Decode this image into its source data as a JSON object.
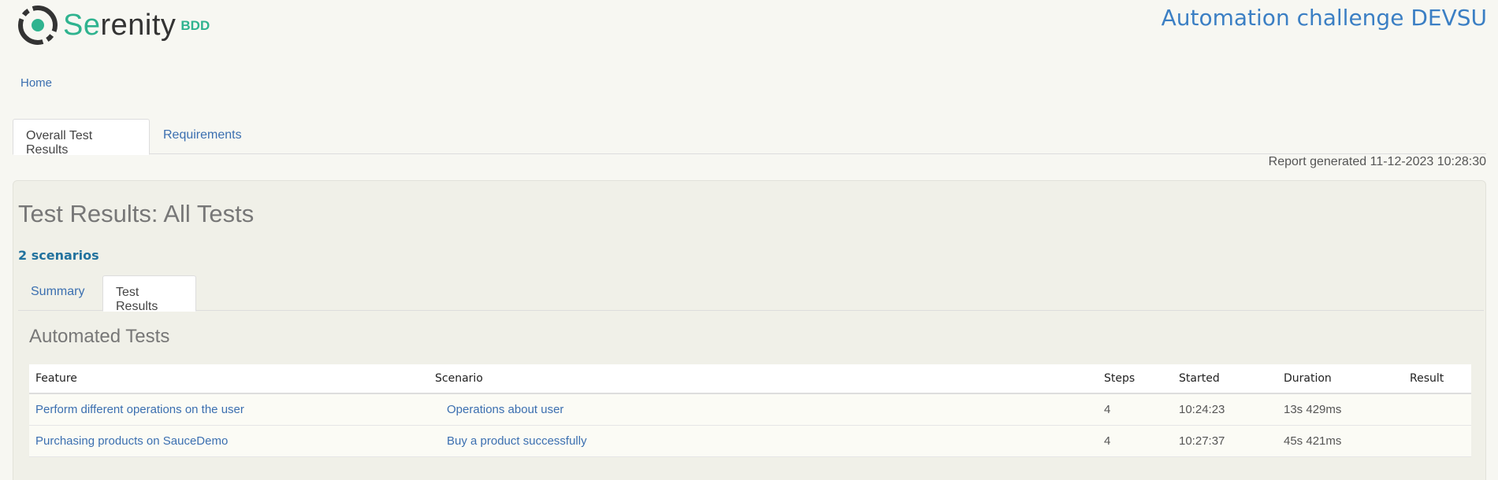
{
  "header": {
    "logo_prefix": "Se",
    "logo_rest": "renity",
    "logo_suffix": "BDD",
    "project_title": "Automation challenge DEVSU"
  },
  "breadcrumb": {
    "home": "Home"
  },
  "top_tabs": [
    {
      "label": "Overall Test Results",
      "active": true
    },
    {
      "label": "Requirements",
      "active": false
    }
  ],
  "report_generated": "Report generated 11-12-2023 10:28:30",
  "results": {
    "title": "Test Results: All Tests",
    "scenario_count": "2 scenarios",
    "tabs": [
      {
        "label": "Summary",
        "active": false
      },
      {
        "label": "Test Results",
        "active": true
      }
    ],
    "section_title": "Automated Tests"
  },
  "table": {
    "columns": [
      "Feature",
      "Scenario",
      "Steps",
      "Started",
      "Duration",
      "Result"
    ],
    "rows": [
      {
        "feature": "Perform different operations on the user",
        "scenario": "Operations about user",
        "steps": "4",
        "started": "10:24:23",
        "duration": "13s 429ms",
        "result": ""
      },
      {
        "feature": "Purchasing products on SauceDemo",
        "scenario": "Buy a product successfully",
        "steps": "4",
        "started": "10:27:37",
        "duration": "45s 421ms",
        "result": ""
      }
    ]
  },
  "colors": {
    "brand_green": "#2fb38f",
    "link_blue": "#3b6fb0",
    "title_blue": "#3b7fc4",
    "count_blue": "#22729e"
  },
  "icons": {
    "logo": "serenity-logo-icon"
  }
}
